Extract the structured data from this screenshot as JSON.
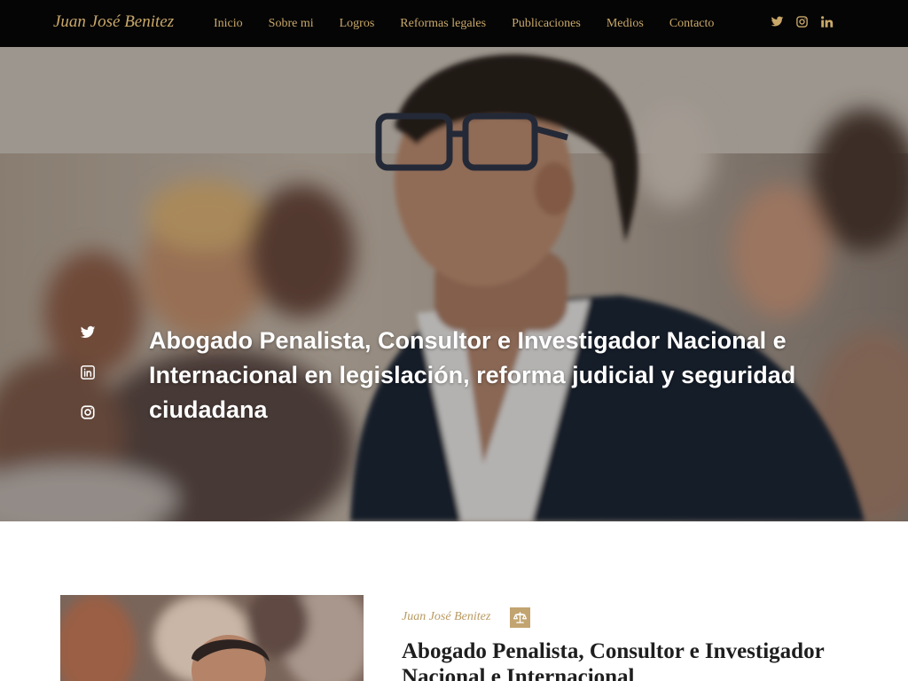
{
  "brand": {
    "name": "Juan José Benitez"
  },
  "nav": {
    "links": [
      {
        "label": "Inicio"
      },
      {
        "label": "Sobre mi"
      },
      {
        "label": "Logros"
      },
      {
        "label": "Reformas legales"
      },
      {
        "label": "Publicaciones"
      },
      {
        "label": "Medios"
      },
      {
        "label": "Contacto"
      }
    ],
    "social_icons": [
      "twitter-icon",
      "instagram-icon",
      "linkedin-icon"
    ]
  },
  "hero": {
    "headline": "Abogado Penalista, Consultor e Investigador Nacional e Internacional en legislación, reforma judicial y seguridad ciudadana",
    "social_icons": [
      "twitter-icon",
      "linkedin-icon",
      "instagram-icon"
    ]
  },
  "about": {
    "kicker": "Juan José Benitez",
    "badge_icon": "scale-icon",
    "title": "Abogado Penalista, Consultor e Investigador Nacional e Internacional"
  },
  "colors": {
    "nav_bg": "#050505",
    "accent_gold": "#c9a86a",
    "badge_gold": "#c2a470",
    "hero_text": "#ffffff",
    "title_text": "#1e1e1e"
  }
}
